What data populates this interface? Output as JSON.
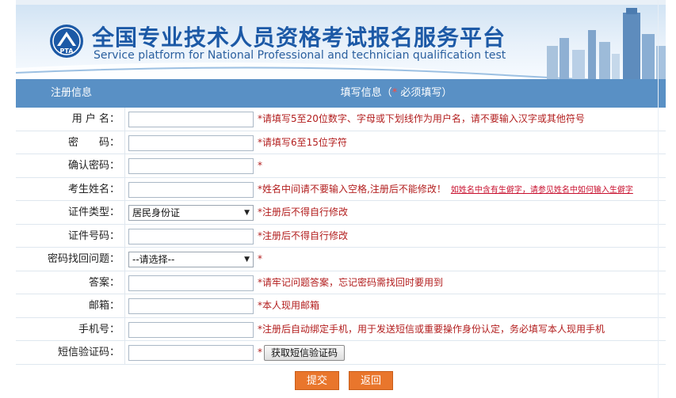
{
  "banner": {
    "title_cn": "全国专业技术人员资格考试报名服务平台",
    "title_en": "Service platform for National Professional and technician  qualification test",
    "logo_text": "PTA"
  },
  "table_header": {
    "col1": "注册信息",
    "col2_prefix": "填写信息（",
    "col2_star": "*",
    "col2_suffix": " 必须填写）"
  },
  "form": {
    "rows": [
      {
        "label": "用 户 名：",
        "hint": "*请填写5至20位数字、字母或下划线作为用户名，请不要输入汉字或其他符号"
      },
      {
        "label": "密　　码：",
        "hint": "*请填写6至15位字符"
      },
      {
        "label": "确认密码：",
        "hint": "*"
      },
      {
        "label": "考生姓名：",
        "hint": "*姓名中间请不要输入空格,注册后不能修改！",
        "link": "如姓名中含有生僻字，请参见姓名中如何输入生僻字"
      },
      {
        "label": "证件类型：",
        "select_value": "居民身份证",
        "hint": "*注册后不得自行修改"
      },
      {
        "label": "证件号码：",
        "hint": "*注册后不得自行修改"
      },
      {
        "label": "密码找回问题：",
        "select_value": "--请选择--",
        "hint": "*"
      },
      {
        "label": "答案：",
        "hint": "*请牢记问题答案，忘记密码需找回时要用到"
      },
      {
        "label": "邮箱：",
        "hint": "*本人现用邮箱"
      },
      {
        "label": "手机号：",
        "hint": "*注册后自动绑定手机，用于发送短信或重要操作身份认定，务必填写本人现用手机"
      },
      {
        "label": "短信验证码：",
        "hint": "*",
        "button": "获取短信验证码"
      }
    ]
  },
  "footer": {
    "submit": "提交",
    "back": "返回"
  },
  "colors": {
    "header_bar": "#5990c5",
    "hint_text": "#b21d1d",
    "button": "#e9762c",
    "title": "#1c59a6"
  }
}
